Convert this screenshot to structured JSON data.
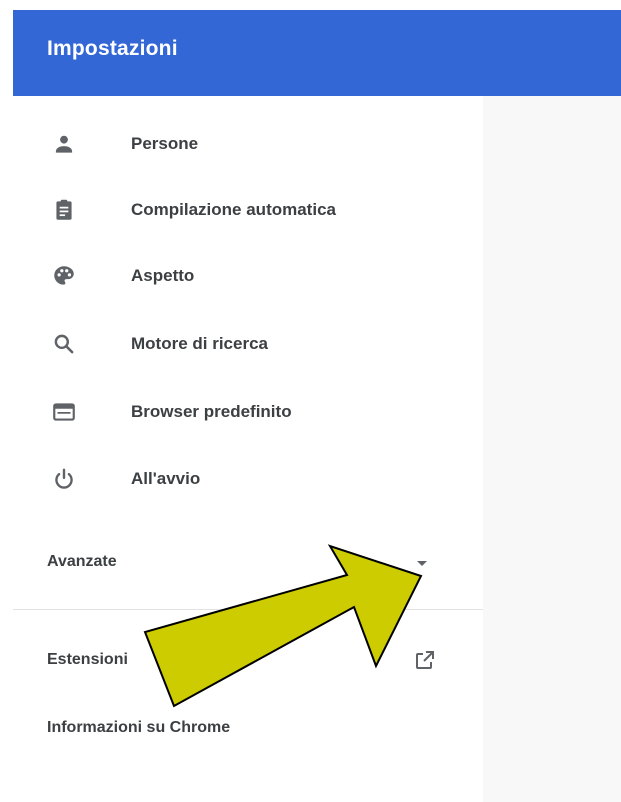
{
  "header": {
    "title": "Impostazioni",
    "background_color": "#3367d6"
  },
  "menu": {
    "items": [
      {
        "label": "Persone",
        "icon": "person-icon"
      },
      {
        "label": "Compilazione automatica",
        "icon": "clipboard-icon"
      },
      {
        "label": "Aspetto",
        "icon": "palette-icon"
      },
      {
        "label": "Motore di ricerca",
        "icon": "search-icon"
      },
      {
        "label": "Browser predefinito",
        "icon": "browser-window-icon"
      },
      {
        "label": "All'avvio",
        "icon": "power-icon"
      }
    ]
  },
  "advanced": {
    "label": "Avanzate",
    "icon": "caret-down-icon"
  },
  "footer_links": {
    "extensions_label": "Estensioni",
    "extensions_icon": "open-in-new-icon",
    "about_label": "Informazioni su Chrome"
  },
  "annotation": {
    "arrow_color": "#cccc00",
    "arrow_outline": "#000000"
  }
}
